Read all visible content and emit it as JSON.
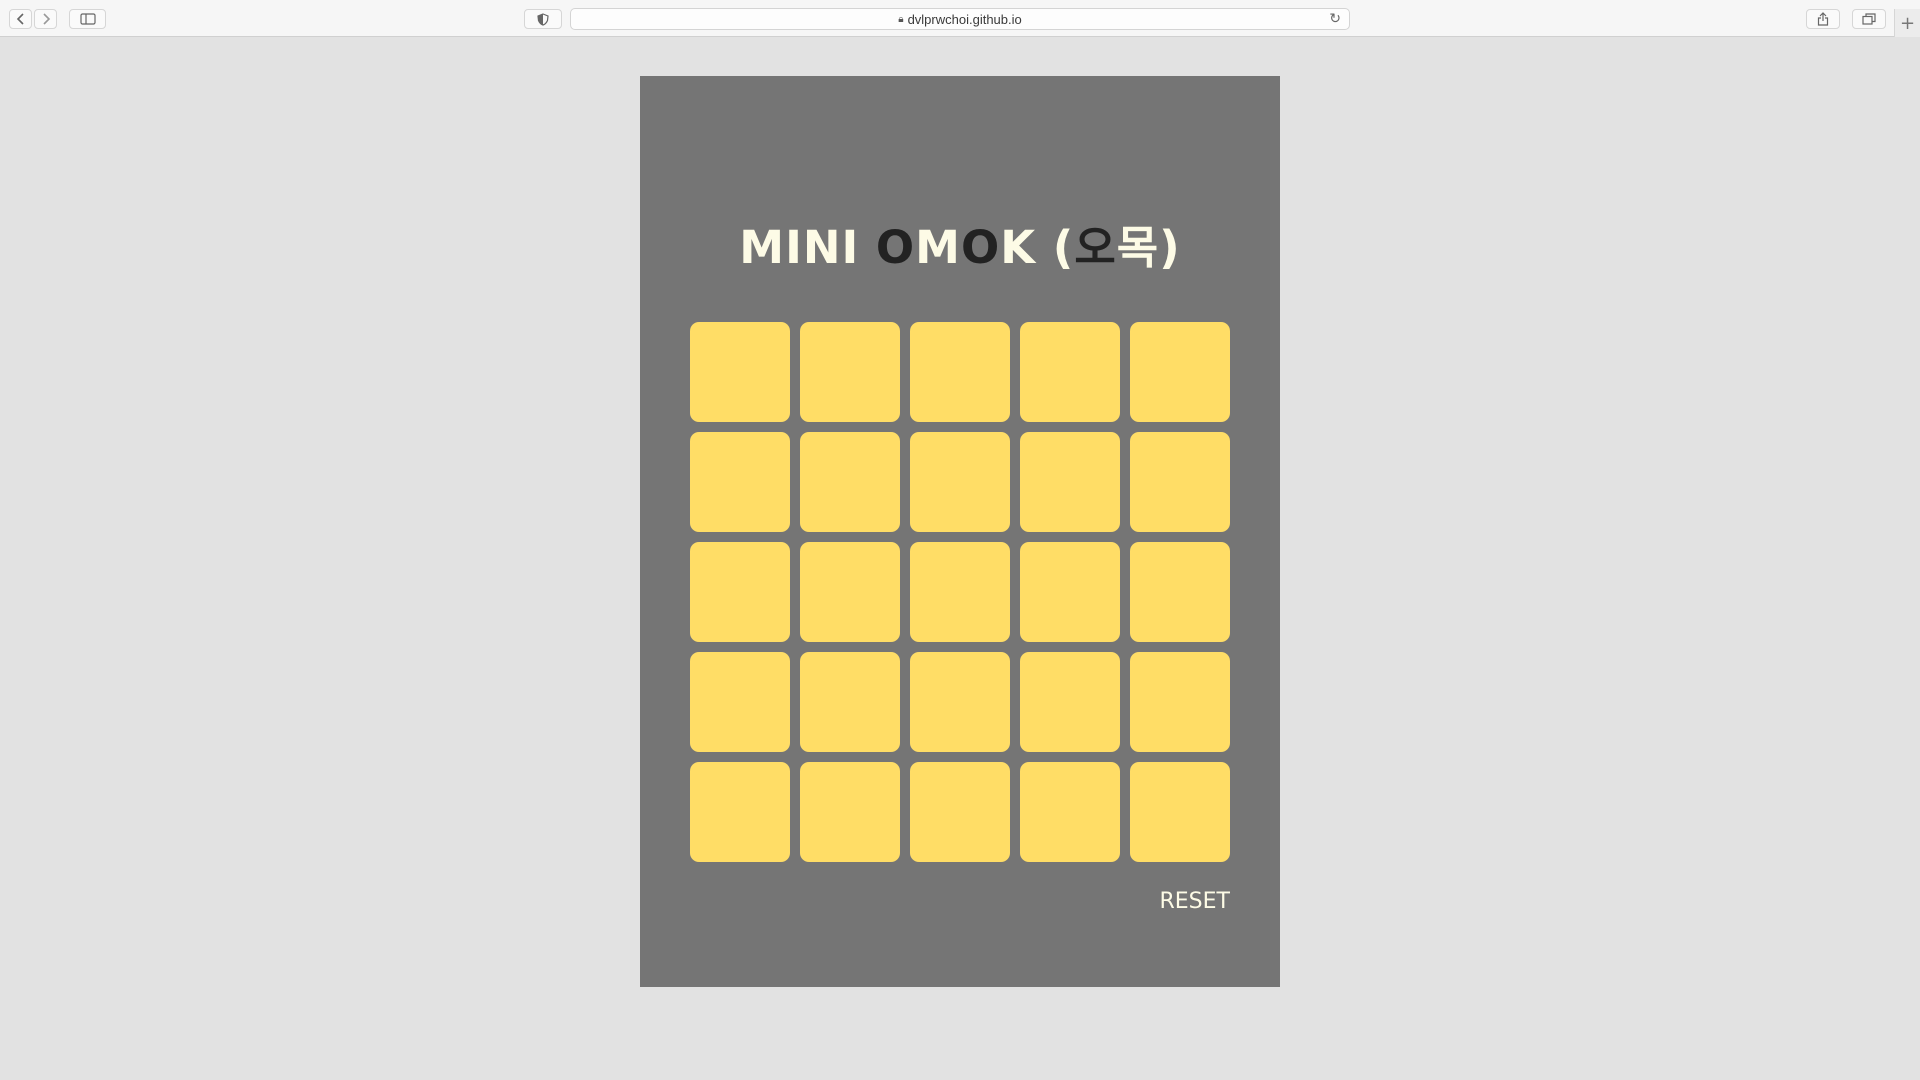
{
  "browser": {
    "url": "dvlprwchoi.github.io",
    "icons": {
      "back": "chevron-left-icon",
      "forward": "chevron-right-icon",
      "sidebar": "sidebar-icon",
      "privacy": "shield-icon",
      "lock": "lock-icon",
      "reload": "reload-icon",
      "share": "share-icon",
      "tabs": "tabs-overview-icon",
      "new_tab": "plus-icon"
    }
  },
  "game": {
    "title_parts": [
      "MINI ",
      "O",
      "M",
      "O",
      "K (",
      "오",
      "목)"
    ],
    "board": {
      "rows": 5,
      "cols": 5,
      "cell_color": "#ffdd66",
      "cells": [
        [
          "",
          "",
          "",
          "",
          ""
        ],
        [
          "",
          "",
          "",
          "",
          ""
        ],
        [
          "",
          "",
          "",
          "",
          ""
        ],
        [
          "",
          "",
          "",
          "",
          ""
        ],
        [
          "",
          "",
          "",
          "",
          ""
        ]
      ]
    },
    "reset_label": "RESET",
    "colors": {
      "page_bg": "#e2e2e2",
      "panel_bg": "#757575",
      "title_light": "#fdfbe6",
      "title_dark": "#222222"
    }
  }
}
